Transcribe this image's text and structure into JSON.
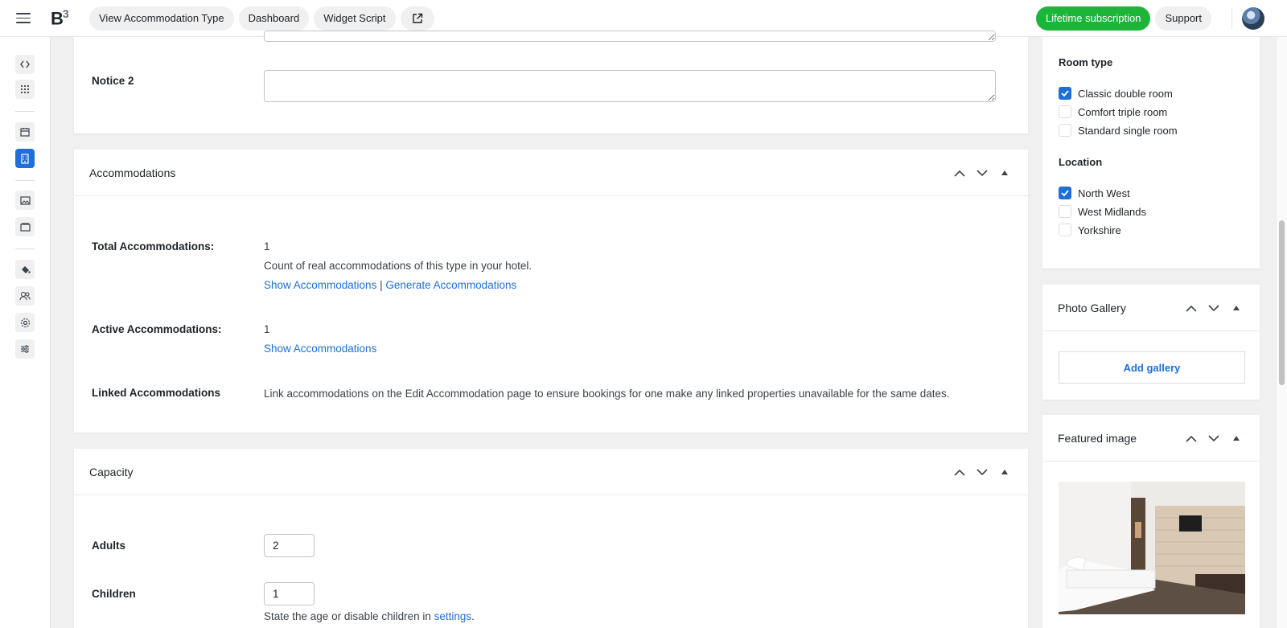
{
  "topbar": {
    "view_type_label": "View Accommodation Type",
    "dashboard_label": "Dashboard",
    "widget_label": "Widget Script",
    "subscription_label": "Lifetime subscription",
    "support_label": "Support",
    "logo_text": "B",
    "logo_sup": "3"
  },
  "notice2": {
    "label": "Notice 2",
    "value": ""
  },
  "accommodations": {
    "title": "Accommodations",
    "total_label": "Total Accommodations:",
    "total_value": "1",
    "total_desc": "Count of real accommodations of this type in your hotel.",
    "show_link": "Show Accommodations",
    "separator": "|",
    "generate_link": "Generate Accommodations",
    "active_label": "Active Accommodations:",
    "active_value": "1",
    "active_show_link": "Show Accommodations",
    "linked_label": "Linked Accommodations",
    "linked_desc": "Link accommodations on the Edit Accommodation page to ensure bookings for one make any linked properties unavailable for the same dates."
  },
  "capacity": {
    "title": "Capacity",
    "adults_label": "Adults",
    "adults_value": "2",
    "children_label": "Children",
    "children_value": "1",
    "children_desc_prefix": "State the age or disable children in ",
    "children_desc_link": "settings",
    "children_desc_suffix": "."
  },
  "sidebar": {
    "room_type_title": "Room type",
    "room_types": [
      {
        "label": "Classic double room",
        "checked": true
      },
      {
        "label": "Comfort triple room",
        "checked": false
      },
      {
        "label": "Standard single room",
        "checked": false
      }
    ],
    "location_title": "Location",
    "locations": [
      {
        "label": "North West",
        "checked": true
      },
      {
        "label": "West Midlands",
        "checked": false
      },
      {
        "label": "Yorkshire",
        "checked": false
      }
    ],
    "gallery_title": "Photo Gallery",
    "add_gallery_label": "Add gallery",
    "featured_title": "Featured image"
  },
  "colors": {
    "accent": "#1f6fd9",
    "subscription_green": "#1cb53a"
  }
}
